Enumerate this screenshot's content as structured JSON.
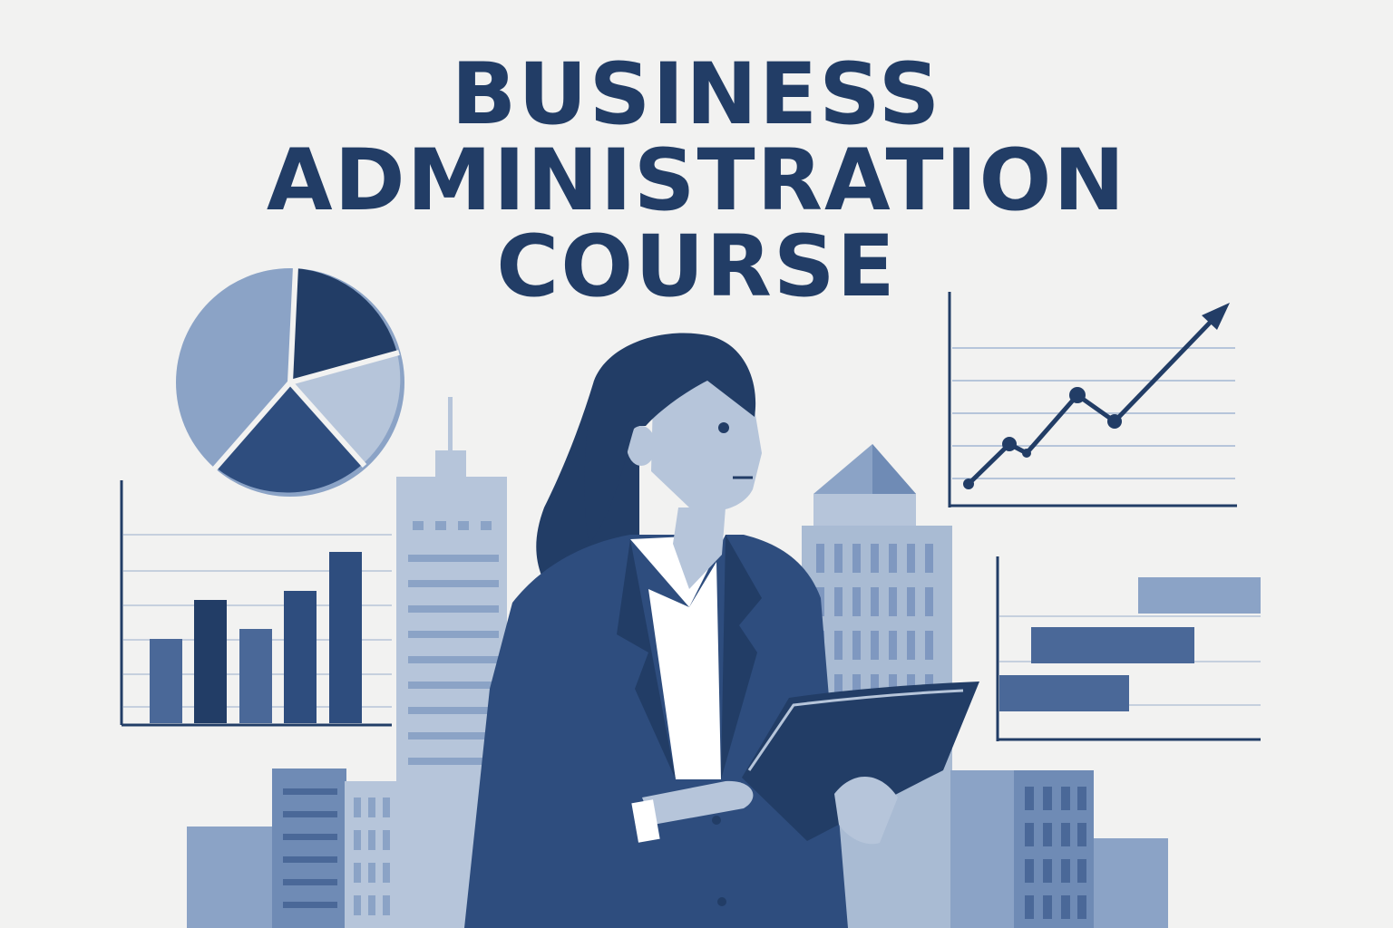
{
  "title": {
    "lines": [
      "BUSINESS",
      "ADMINISTRATION",
      "COURSE"
    ]
  },
  "colors": {
    "background": "#f2f2f1",
    "navy": "#223d66",
    "mid_blue": "#4a6898",
    "light_blue": "#8ba3c6",
    "pale_blue": "#b6c5da",
    "white": "#ffffff"
  },
  "illustration": {
    "subject": "businesswoman-holding-folder",
    "pie_chart": {
      "type": "pie",
      "slices": [
        22,
        14,
        20,
        44
      ]
    },
    "bar_chart": {
      "type": "bar",
      "values": [
        3,
        5,
        3.5,
        5.3,
        6.6
      ]
    },
    "line_chart": {
      "type": "line",
      "values": [
        1,
        2.5,
        2.5,
        4.8,
        3.8,
        6.5,
        8.2
      ],
      "has_arrow": true
    },
    "hbar_chart": {
      "type": "bar",
      "orientation": "horizontal",
      "values": [
        5.3,
        6.5,
        5.9
      ]
    }
  }
}
